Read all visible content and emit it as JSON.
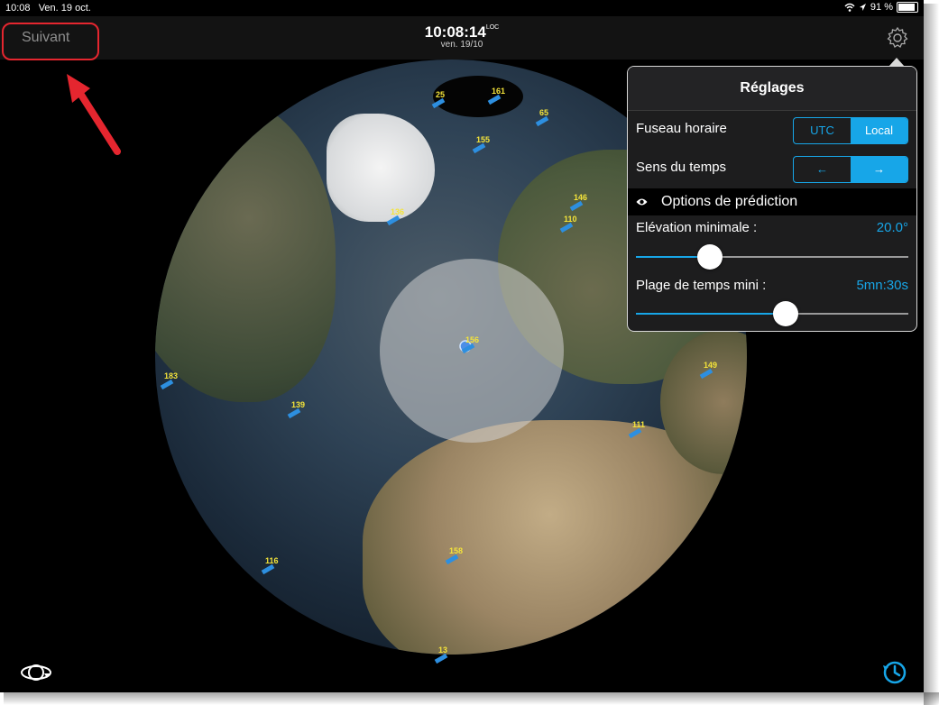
{
  "status_bar": {
    "time": "10:08",
    "date": "Ven. 19 oct.",
    "battery": "91 %"
  },
  "nav": {
    "back_label": "Suivant",
    "clock_time": "10:08:14",
    "clock_suffix": "LOC",
    "clock_date": "ven. 19/10"
  },
  "map": {
    "satellites": [
      "25",
      "161",
      "65",
      "155",
      "136",
      "110",
      "146",
      "156",
      "139",
      "111",
      "149",
      "158",
      "116",
      "183",
      "13"
    ]
  },
  "settings": {
    "title": "Réglages",
    "timezone_label": "Fuseau horaire",
    "timezone_options": [
      "UTC",
      "Local"
    ],
    "timezone_selected": "Local",
    "time_direction_label": "Sens du temps",
    "time_direction_options": [
      "←",
      "→"
    ],
    "time_direction_selected": "→",
    "prediction_section": "Options de prédiction",
    "min_elevation_label": "Elévation minimale :",
    "min_elevation_value": "20.0°",
    "min_elevation_fraction": 0.27,
    "min_time_label": "Plage de temps mini :",
    "min_time_value": "5mn:30s",
    "min_time_fraction": 0.55
  },
  "colors": {
    "accent": "#17a6e8",
    "annotation": "#e5262f",
    "satellite_label": "#f4e43a"
  }
}
